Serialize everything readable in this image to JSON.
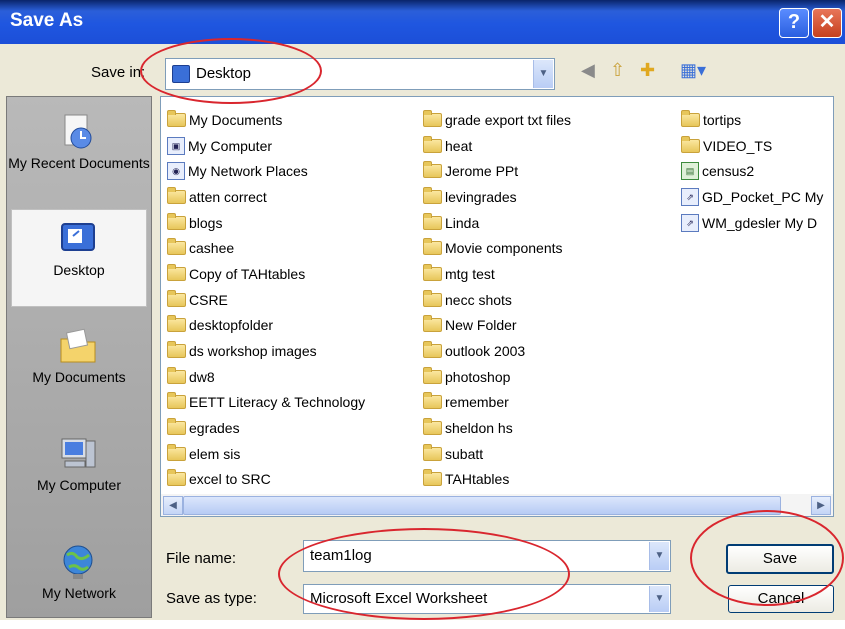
{
  "window": {
    "title": "Save As",
    "help_label": "?",
    "close_label": "✕"
  },
  "toolbar": {
    "save_in_label": "Save in:",
    "location": "Desktop",
    "icons": [
      "back-icon",
      "up-folder-icon",
      "new-folder-icon",
      "views-menu-icon"
    ]
  },
  "places": [
    {
      "name": "my-recent-documents",
      "label": "My Recent Documents",
      "icon": "recent-documents-icon",
      "selected": false
    },
    {
      "name": "desktop",
      "label": "Desktop",
      "icon": "desktop-icon",
      "selected": true
    },
    {
      "name": "my-documents",
      "label": "My Documents",
      "icon": "my-documents-icon",
      "selected": false
    },
    {
      "name": "my-computer",
      "label": "My Computer",
      "icon": "my-computer-icon",
      "selected": false
    },
    {
      "name": "my-network",
      "label": "My Network",
      "icon": "my-network-icon",
      "selected": false
    }
  ],
  "files": {
    "col1": [
      "My Documents",
      "My Computer",
      "My Network Places",
      "atten correct",
      "blogs",
      "cashee",
      "Copy of TAHtables",
      "CSRE",
      "desktopfolder",
      "ds workshop images",
      "dw8",
      "EETT Literacy & Technology",
      "egrades",
      "elem sis",
      "excel to SRC"
    ],
    "col2": [
      "grade export txt files",
      "heat",
      "Jerome PPt",
      "levingrades",
      "Linda",
      "Movie components",
      "mtg test",
      "necc shots",
      "New Folder",
      "outlook 2003",
      "photoshop",
      "remember",
      "sheldon hs",
      "subatt",
      "TAHtables"
    ],
    "col3": [
      "tortips",
      "VIDEO_TS",
      "census2",
      "GD_Pocket_PC My",
      "WM_gdesler My D"
    ]
  },
  "form": {
    "file_name_label": "File name:",
    "file_name_value": "team1log",
    "save_as_type_label": "Save as type:",
    "save_as_type_value": "Microsoft Excel Worksheet"
  },
  "buttons": {
    "save": "Save",
    "cancel": "Cancel"
  },
  "colors": {
    "titlebar": "#1f56e0",
    "highlight_oval": "#d9262e",
    "dialog_bg": "#ece9d8"
  }
}
